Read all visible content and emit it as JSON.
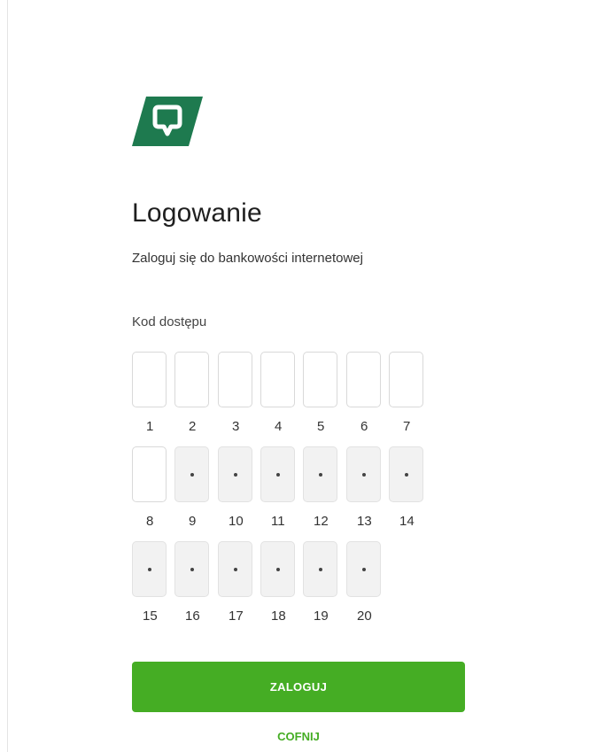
{
  "brand": {
    "logo_icon": "bank-logo-icon",
    "logo_color": "#1e7a4f"
  },
  "login": {
    "title": "Logowanie",
    "subtitle": "Zaloguj się do bankowości internetowej",
    "code_label": "Kod dostępu",
    "cells": [
      {
        "index": "1",
        "masked": false
      },
      {
        "index": "2",
        "masked": false
      },
      {
        "index": "3",
        "masked": false
      },
      {
        "index": "4",
        "masked": false
      },
      {
        "index": "5",
        "masked": false
      },
      {
        "index": "6",
        "masked": false
      },
      {
        "index": "7",
        "masked": false
      },
      {
        "index": "8",
        "masked": false
      },
      {
        "index": "9",
        "masked": true
      },
      {
        "index": "10",
        "masked": true
      },
      {
        "index": "11",
        "masked": true
      },
      {
        "index": "12",
        "masked": true
      },
      {
        "index": "13",
        "masked": true
      },
      {
        "index": "14",
        "masked": true
      },
      {
        "index": "15",
        "masked": true
      },
      {
        "index": "16",
        "masked": true
      },
      {
        "index": "17",
        "masked": true
      },
      {
        "index": "18",
        "masked": true
      },
      {
        "index": "19",
        "masked": true
      },
      {
        "index": "20",
        "masked": true
      }
    ],
    "submit_label": "ZALOGUJ",
    "back_label": "COFNIJ"
  },
  "colors": {
    "accent": "#45ad24",
    "masked_bg": "#f2f2f2"
  }
}
